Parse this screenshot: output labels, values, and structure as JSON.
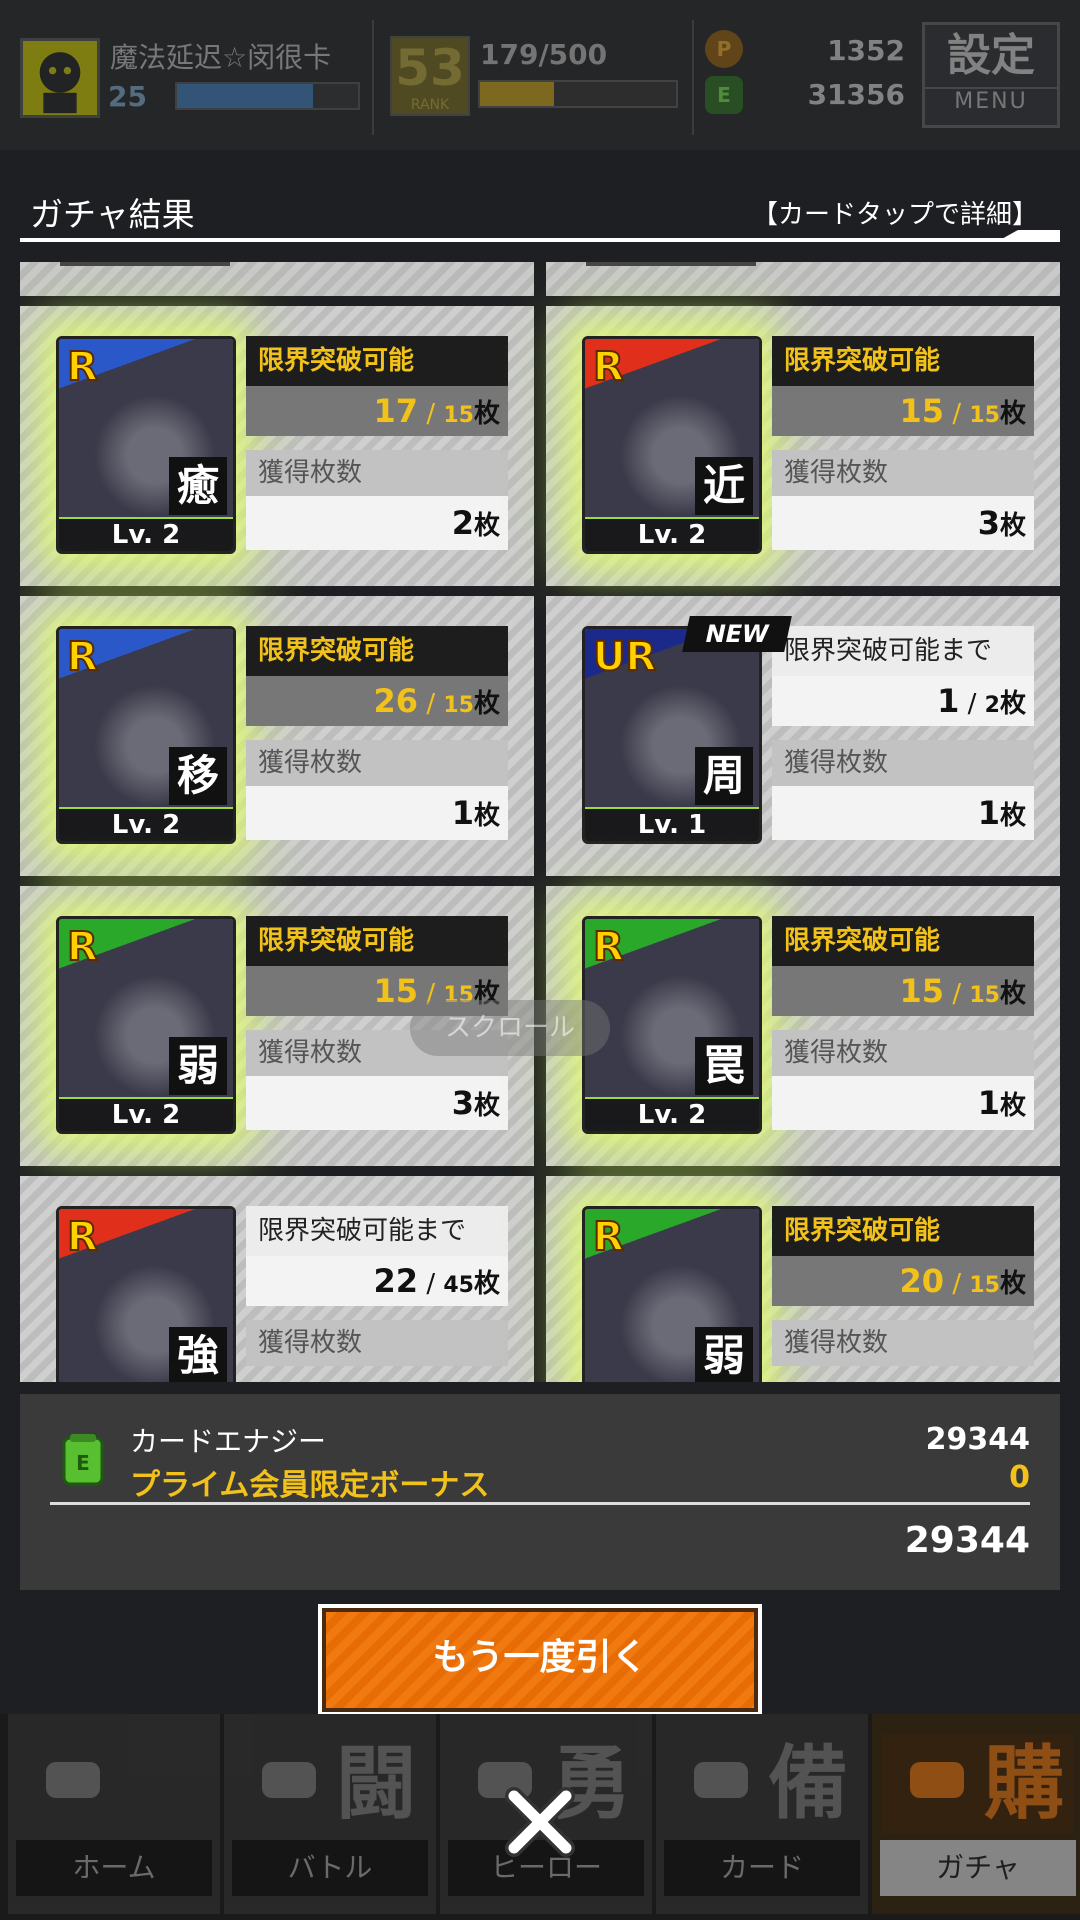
{
  "header": {
    "player_name": "魔法延迟☆闵很卡",
    "player_level": "25",
    "exp_fraction": 0.75,
    "rank": "53",
    "rank_label": "RANK",
    "stamina": "179/500",
    "stamina_fraction": 0.38,
    "coin_value": "1352",
    "energy_value": "31356",
    "menu_kanji": "設定",
    "menu_label": "MENU"
  },
  "result": {
    "title": "ガチャ結果",
    "hint": "【カードタップで詳細】",
    "scroll_hint": "スクロール"
  },
  "cards": [
    {
      "rarity": "R",
      "kanji": "癒",
      "level": "Lv. 2",
      "status": "限界突破可能",
      "count": "17",
      "max": "15",
      "unit": "枚",
      "obtained_label": "獲得枚数",
      "obtained": "2",
      "glow": true,
      "new": false,
      "theme": "#2a58c8"
    },
    {
      "rarity": "R",
      "kanji": "近",
      "level": "Lv. 2",
      "status": "限界突破可能",
      "count": "15",
      "max": "15",
      "unit": "枚",
      "obtained_label": "獲得枚数",
      "obtained": "3",
      "glow": true,
      "new": false,
      "theme": "#e0301c"
    },
    {
      "rarity": "R",
      "kanji": "移",
      "level": "Lv. 2",
      "status": "限界突破可能",
      "count": "26",
      "max": "15",
      "unit": "枚",
      "obtained_label": "獲得枚数",
      "obtained": "1",
      "glow": true,
      "new": false,
      "theme": "#2a58c8"
    },
    {
      "rarity": "UR",
      "kanji": "周",
      "level": "Lv. 1",
      "status": "限界突破可能まで",
      "count": "1",
      "max": "2",
      "unit": "枚",
      "obtained_label": "獲得枚数",
      "obtained": "1",
      "glow": false,
      "new": true,
      "new_label": "NEW",
      "theme": "#1b2a8a"
    },
    {
      "rarity": "R",
      "kanji": "弱",
      "level": "Lv. 2",
      "status": "限界突破可能",
      "count": "15",
      "max": "15",
      "unit": "枚",
      "obtained_label": "獲得枚数",
      "obtained": "3",
      "glow": true,
      "new": false,
      "theme": "#2aa82a"
    },
    {
      "rarity": "R",
      "kanji": "罠",
      "level": "Lv. 2",
      "status": "限界突破可能",
      "count": "15",
      "max": "15",
      "unit": "枚",
      "obtained_label": "獲得枚数",
      "obtained": "1",
      "glow": true,
      "new": false,
      "theme": "#2aa82a"
    },
    {
      "rarity": "R",
      "kanji": "強",
      "level": "",
      "status": "限界突破可能まで",
      "count": "22",
      "max": "45",
      "unit": "枚",
      "obtained_label": "獲得枚数",
      "obtained": "",
      "glow": false,
      "new": false,
      "theme": "#e0301c"
    },
    {
      "rarity": "R",
      "kanji": "弱",
      "level": "",
      "status": "限界突破可能",
      "count": "20",
      "max": "15",
      "unit": "枚",
      "obtained_label": "獲得枚数",
      "obtained": "",
      "glow": true,
      "new": false,
      "theme": "#2aa82a"
    }
  ],
  "energy": {
    "label": "カードエナジー",
    "bonus_label": "プライム会員限定ボーナス",
    "value": "29344",
    "bonus_value": "0",
    "total": "29344"
  },
  "draw_again": "もう一度引く",
  "nav": [
    {
      "label": "ホーム",
      "kanji": "",
      "icon": "home-icon"
    },
    {
      "label": "バトル",
      "kanji": "闘",
      "icon": "gamepad-icon"
    },
    {
      "label": "ヒーロー",
      "kanji": "勇",
      "icon": "hero-icon"
    },
    {
      "label": "カード",
      "kanji": "備",
      "icon": "cards-icon"
    },
    {
      "label": "ガチャ",
      "kanji": "購",
      "icon": "gacha-icon"
    }
  ],
  "colors": {
    "accent": "#f07a10",
    "gold": "#f2c21b"
  }
}
